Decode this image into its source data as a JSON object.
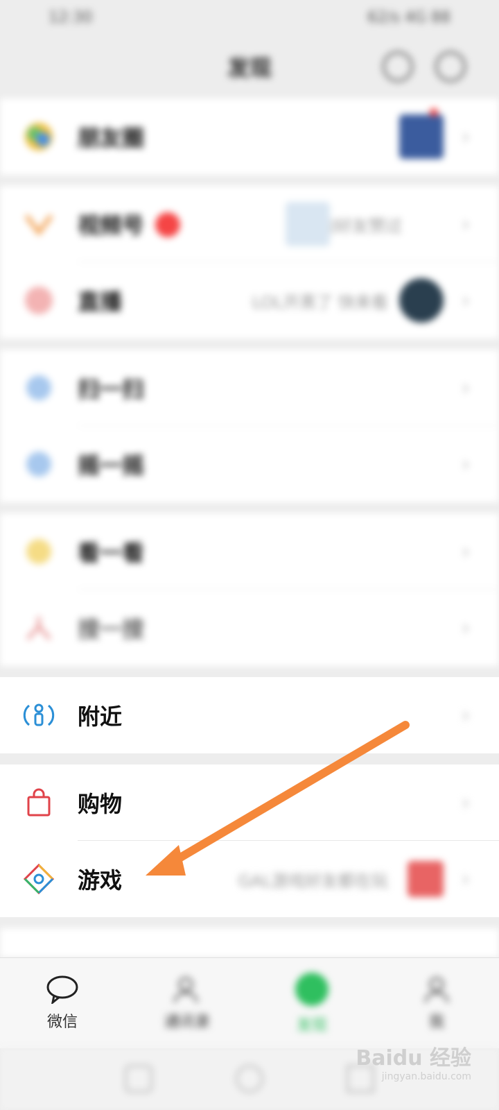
{
  "status_bar": {
    "left": "12:30",
    "right": "62/s 4G 88"
  },
  "top_bar": {
    "title": "发现"
  },
  "rows": {
    "moments": {
      "label": "朋友圈"
    },
    "channels": {
      "label": "视频号",
      "detail": "你的好友赞过"
    },
    "live": {
      "label": "直播",
      "detail": "LOL开黑了 快来看"
    },
    "scan": {
      "label": "扫一扫"
    },
    "shake": {
      "label": "摇一摇"
    },
    "top_stories": {
      "label": "看一看"
    },
    "search": {
      "label": "搜一搜"
    },
    "nearby": {
      "label": "附近"
    },
    "shopping": {
      "label": "购物"
    },
    "games": {
      "label": "游戏",
      "detail": "GAL游戏好友都在玩"
    }
  },
  "tabs": [
    {
      "label": "微信"
    },
    {
      "label": "通讯录"
    },
    {
      "label": "发现"
    },
    {
      "label": "我"
    }
  ],
  "watermark": {
    "brand": "Baidu 经验",
    "url": "jingyan.baidu.com"
  },
  "colors": {
    "accent_arrow": "#f5883a",
    "nearby_icon": "#2b8fd6",
    "shopping_icon": "#e0434a"
  }
}
